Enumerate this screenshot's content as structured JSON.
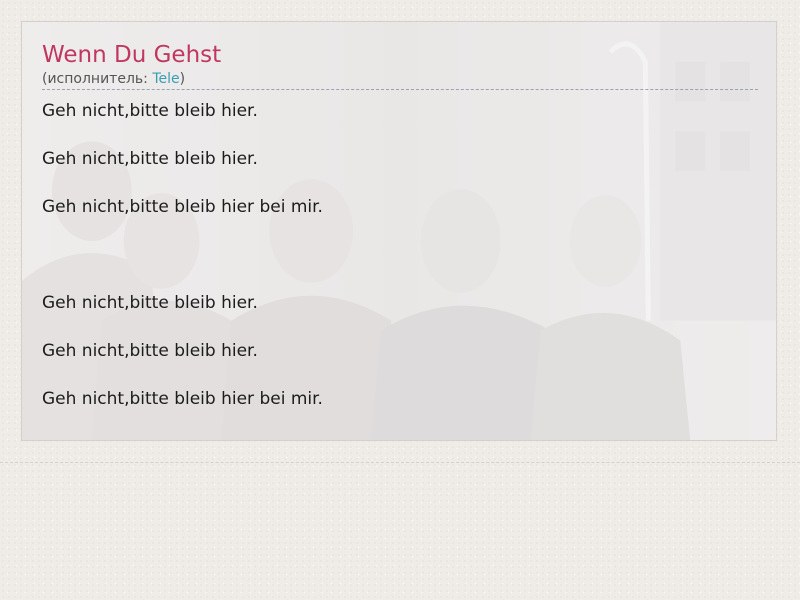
{
  "song": {
    "title": "Wenn Du Gehst",
    "artist_prefix": "(исполнитель: ",
    "artist_name": "Tele",
    "artist_suffix": ")"
  },
  "lyrics": [
    "Geh nicht,bitte bleib hier.",
    "Geh nicht,bitte bleib hier.",
    "Geh nicht,bitte bleib hier bei mir.",
    "",
    "Geh nicht,bitte bleib hier.",
    "Geh nicht,bitte bleib hier.",
    "Geh nicht,bitte bleib hier bei mir."
  ],
  "colors": {
    "title": "#c0375f",
    "link": "#3a9fb3",
    "page_background": "#efebe6"
  }
}
